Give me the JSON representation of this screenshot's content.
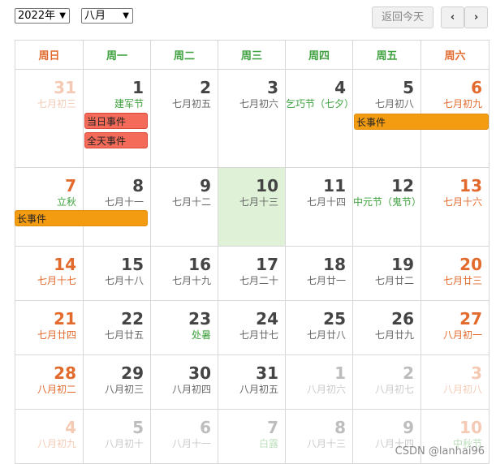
{
  "toolbar": {
    "year_value": "2022年",
    "month_value": "八月",
    "today_label": "返回今天",
    "prev_label": "‹",
    "next_label": "›"
  },
  "weekdays": [
    "周日",
    "周一",
    "周二",
    "周三",
    "周四",
    "周五",
    "周六"
  ],
  "colors": {
    "weekend": "#e26a2c",
    "weekday": "#444444",
    "festival": "#3fa13f",
    "today_bg": "#dff1d6",
    "event_red": "#f46b5a",
    "event_orange": "#f39c12"
  },
  "weeks": [
    [
      {
        "day": "31",
        "lunar": "七月初三",
        "muted": true
      },
      {
        "day": "1",
        "lunar": "建军节",
        "festival": true
      },
      {
        "day": "2",
        "lunar": "七月初五"
      },
      {
        "day": "3",
        "lunar": "七月初六"
      },
      {
        "day": "4",
        "lunar": "乞巧节（七夕）",
        "festival": true
      },
      {
        "day": "5",
        "lunar": "七月初八"
      },
      {
        "day": "6",
        "lunar": "七月初九"
      }
    ],
    [
      {
        "day": "7",
        "lunar": "立秋",
        "festival": true
      },
      {
        "day": "8",
        "lunar": "七月十一"
      },
      {
        "day": "9",
        "lunar": "七月十二"
      },
      {
        "day": "10",
        "lunar": "七月十三",
        "today": true
      },
      {
        "day": "11",
        "lunar": "七月十四"
      },
      {
        "day": "12",
        "lunar": "中元节（鬼节）",
        "festival": true
      },
      {
        "day": "13",
        "lunar": "七月十六"
      }
    ],
    [
      {
        "day": "14",
        "lunar": "七月十七"
      },
      {
        "day": "15",
        "lunar": "七月十八"
      },
      {
        "day": "16",
        "lunar": "七月十九"
      },
      {
        "day": "17",
        "lunar": "七月二十"
      },
      {
        "day": "18",
        "lunar": "七月廿一"
      },
      {
        "day": "19",
        "lunar": "七月廿二"
      },
      {
        "day": "20",
        "lunar": "七月廿三"
      }
    ],
    [
      {
        "day": "21",
        "lunar": "七月廿四"
      },
      {
        "day": "22",
        "lunar": "七月廿五"
      },
      {
        "day": "23",
        "lunar": "处暑",
        "festival": true
      },
      {
        "day": "24",
        "lunar": "七月廿七"
      },
      {
        "day": "25",
        "lunar": "七月廿八"
      },
      {
        "day": "26",
        "lunar": "七月廿九"
      },
      {
        "day": "27",
        "lunar": "八月初一"
      }
    ],
    [
      {
        "day": "28",
        "lunar": "八月初二"
      },
      {
        "day": "29",
        "lunar": "八月初三"
      },
      {
        "day": "30",
        "lunar": "八月初四"
      },
      {
        "day": "31",
        "lunar": "八月初五"
      },
      {
        "day": "1",
        "lunar": "八月初六",
        "muted": true
      },
      {
        "day": "2",
        "lunar": "八月初七",
        "muted": true
      },
      {
        "day": "3",
        "lunar": "八月初八",
        "muted": true
      }
    ],
    [
      {
        "day": "4",
        "lunar": "八月初九",
        "muted": true
      },
      {
        "day": "5",
        "lunar": "八月初十",
        "muted": true
      },
      {
        "day": "6",
        "lunar": "八月十一",
        "muted": true
      },
      {
        "day": "7",
        "lunar": "白露",
        "muted": true,
        "festival": true
      },
      {
        "day": "8",
        "lunar": "八月十三",
        "muted": true
      },
      {
        "day": "9",
        "lunar": "八月十四",
        "muted": true
      },
      {
        "day": "10",
        "lunar": "中秋节",
        "muted": true,
        "festival": true
      }
    ]
  ],
  "events": {
    "today_event": "当日事件",
    "all_day_event": "全天事件",
    "long_event_1": "长事件",
    "long_event_2": "长事件"
  },
  "watermark": "CSDN @lanhai96"
}
